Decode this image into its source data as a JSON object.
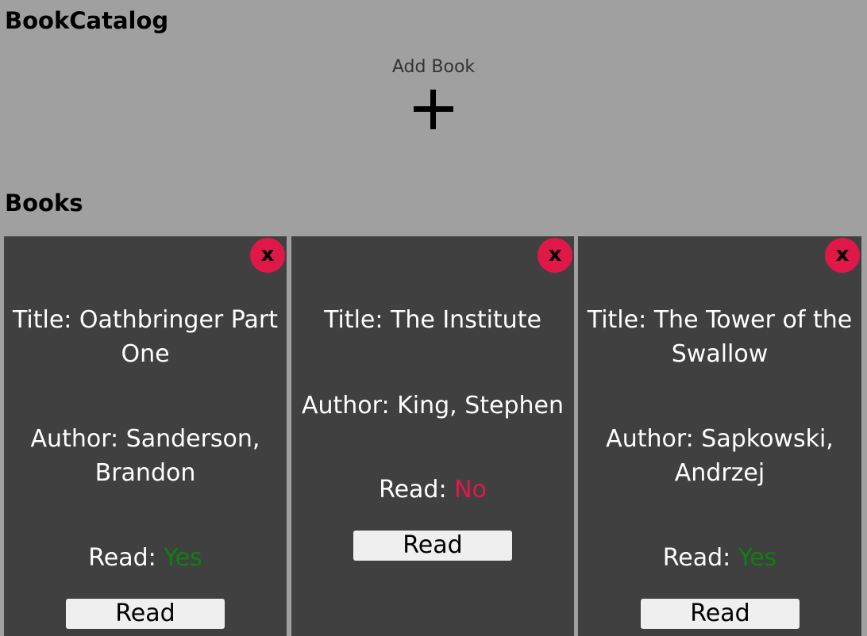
{
  "header": {
    "app_title": "BookCatalog",
    "add_book_label": "Add Book",
    "add_book_icon": "plus-icon"
  },
  "books_heading": "Books",
  "books": [
    {
      "title_label": "Title: Oathbringer Part One",
      "author_label": "Author: Sanderson, Brandon",
      "read_prefix": "Read: ",
      "read_value": "Yes",
      "read_button": "Read",
      "close_label": "x"
    },
    {
      "title_label": "Title: The Institute",
      "author_label": "Author: King, Stephen",
      "read_prefix": "Read: ",
      "read_value": "No",
      "read_button": "Read",
      "close_label": "x"
    },
    {
      "title_label": "Title: The Tower of the Swallow",
      "author_label": "Author: Sapkowski, Andrzej",
      "read_prefix": "Read: ",
      "read_value": "Yes",
      "read_button": "Read",
      "close_label": "x"
    }
  ],
  "colors": {
    "background": "#a0a0a0",
    "card": "#404040",
    "accent_red": "#e0184a",
    "read_yes": "#0e800e",
    "read_no": "#e0184a"
  }
}
